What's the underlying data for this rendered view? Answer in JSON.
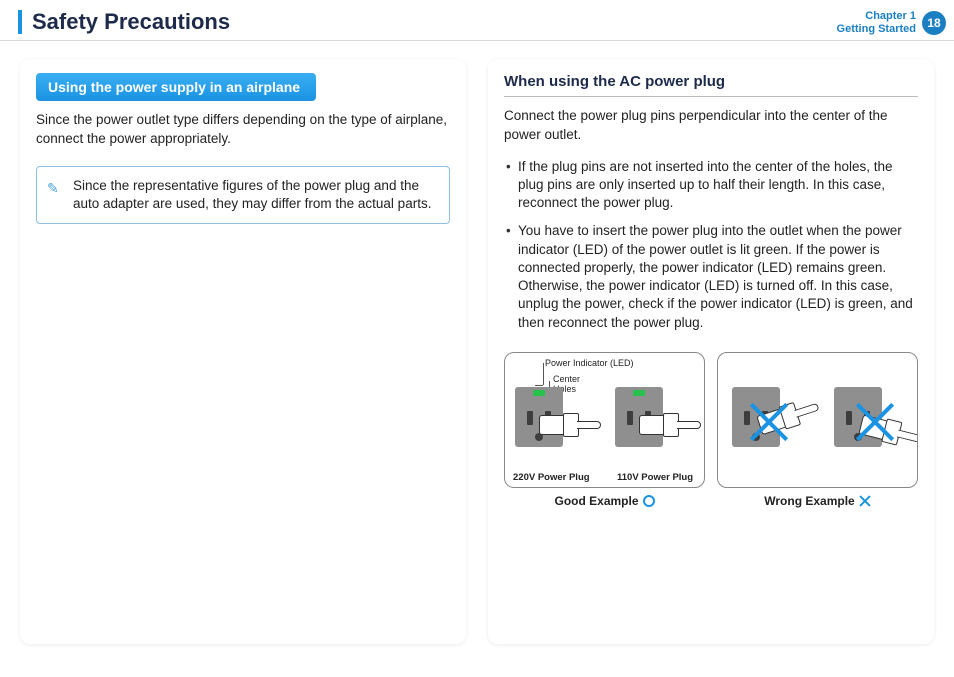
{
  "header": {
    "title": "Safety Precautions",
    "chapter_line1": "Chapter 1",
    "chapter_line2": "Getting Started",
    "page_number": "18"
  },
  "left": {
    "section_title": "Using the power supply in an airplane",
    "intro": "Since the power outlet type differs depending on the type of airplane, connect the power appropriately.",
    "note": "Since the representative figures of the power plug and the auto adapter are used, they may differ from the actual parts."
  },
  "right": {
    "subhead": "When using the AC power plug",
    "intro": "Connect the power plug pins perpendicular into the center of the power outlet.",
    "bullets": [
      "If the plug pins are not inserted into the center of the holes, the plug pins are only inserted up to half their length. In this case, reconnect the power plug.",
      "You have to insert the power plug into the outlet when the power indicator (LED) of the power outlet is lit green. If the power is connected properly, the power indicator (LED) remains green.\nOtherwise, the power indicator (LED) is turned off. In this case, unplug the power, check if the power indicator (LED) is green, and then reconnect the power plug."
    ],
    "figure_good": {
      "label_led": "Power Indicator (LED)",
      "label_center": "Center",
      "label_holes": "Holes",
      "plug_220": "220V Power Plug",
      "plug_110": "110V Power Plug",
      "caption": "Good Example"
    },
    "figure_wrong": {
      "caption": "Wrong Example"
    }
  }
}
